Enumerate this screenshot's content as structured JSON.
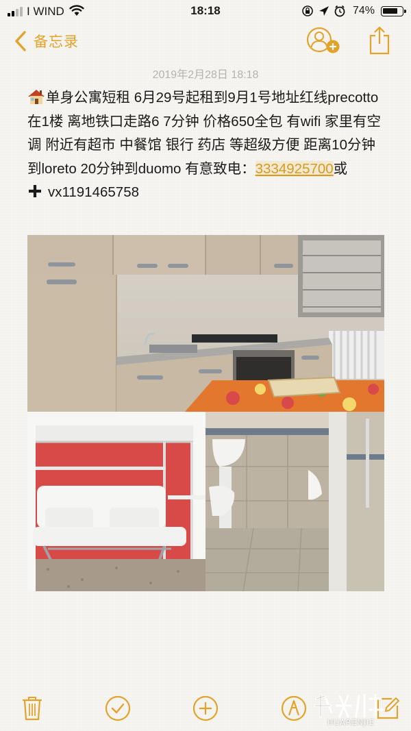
{
  "status_bar": {
    "carrier": "I WIND",
    "time": "18:18",
    "battery": "74%",
    "battery_level": 0.74
  },
  "nav": {
    "back_label": "备忘录"
  },
  "note": {
    "date": "2019年2月28日 18:18",
    "text_before_phone": "单身公寓短租 6月29号起租到9月1号地址红线precotto 在1楼 离地铁口走路6 7分钟 价格650全包 有wifi 家里有空调 附近有超市 中餐馆 银行 药店 等超级方便 距离10分钟到loreto 20分钟到duomo 有意致电：",
    "phone": "3334925700",
    "text_after_phone": "或",
    "wechat": "vx1191465758",
    "emoji_lead": "house-emoji",
    "emoji_wechat": "plus-emoji"
  },
  "photos": [
    {
      "name": "kitchen-photo",
      "icon": "kitchen"
    },
    {
      "name": "bedroom-photo",
      "icon": "sofa-bed"
    },
    {
      "name": "bathroom-photo",
      "icon": "bathroom"
    }
  ],
  "toolbar": {
    "icons": [
      "trash-icon",
      "checklist-icon",
      "compose-plus-icon",
      "markup-icon",
      "new-note-icon"
    ]
  },
  "watermark": {
    "logo_text": "华人街",
    "sub_text": "HUARENJIE"
  },
  "colors": {
    "accent": "#e2a32a",
    "link": "#d59b22",
    "paper": "#f6f5f1",
    "date_gray": "#b3b3b3"
  }
}
